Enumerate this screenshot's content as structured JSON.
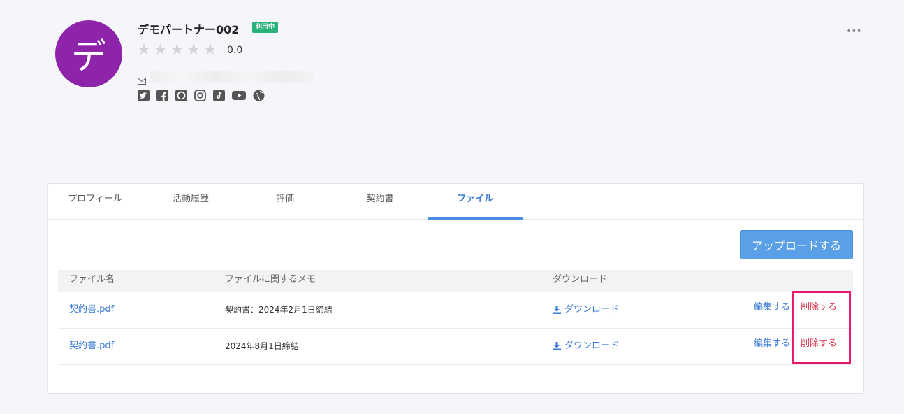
{
  "profile": {
    "avatar_char": "デ",
    "name": "デモパートナー002",
    "status": "利用中",
    "rating": "0.0",
    "star_count": 5,
    "rating_value": 0,
    "colors": {
      "avatar": "#8e24aa",
      "status": "#2ab27b",
      "accent": "#4a90e2",
      "delete": "#d8334a",
      "highlight": "#e8196a"
    },
    "social_icons": [
      "twitter-icon",
      "facebook-icon",
      "github-icon",
      "instagram-icon",
      "tiktok-icon",
      "youtube-icon",
      "globe-icon"
    ]
  },
  "tabs": [
    "プロフィール",
    "活動履歴",
    "評価",
    "契約書",
    "ファイル"
  ],
  "active_tab": "ファイル",
  "upload_label": "アップロードする",
  "table": {
    "headers": [
      "ファイル名",
      "ファイルに関するメモ",
      "ダウンロード"
    ],
    "rows": [
      {
        "file": "契約書.pdf",
        "memo": "契約書：2024年2月1日締結",
        "download": "ダウンロード",
        "edit": "編集する",
        "delete": "削除する"
      },
      {
        "file": "契約書.pdf",
        "memo": "2024年8月1日締結",
        "download": "ダウンロード",
        "edit": "編集する",
        "delete": "削除する"
      }
    ]
  }
}
